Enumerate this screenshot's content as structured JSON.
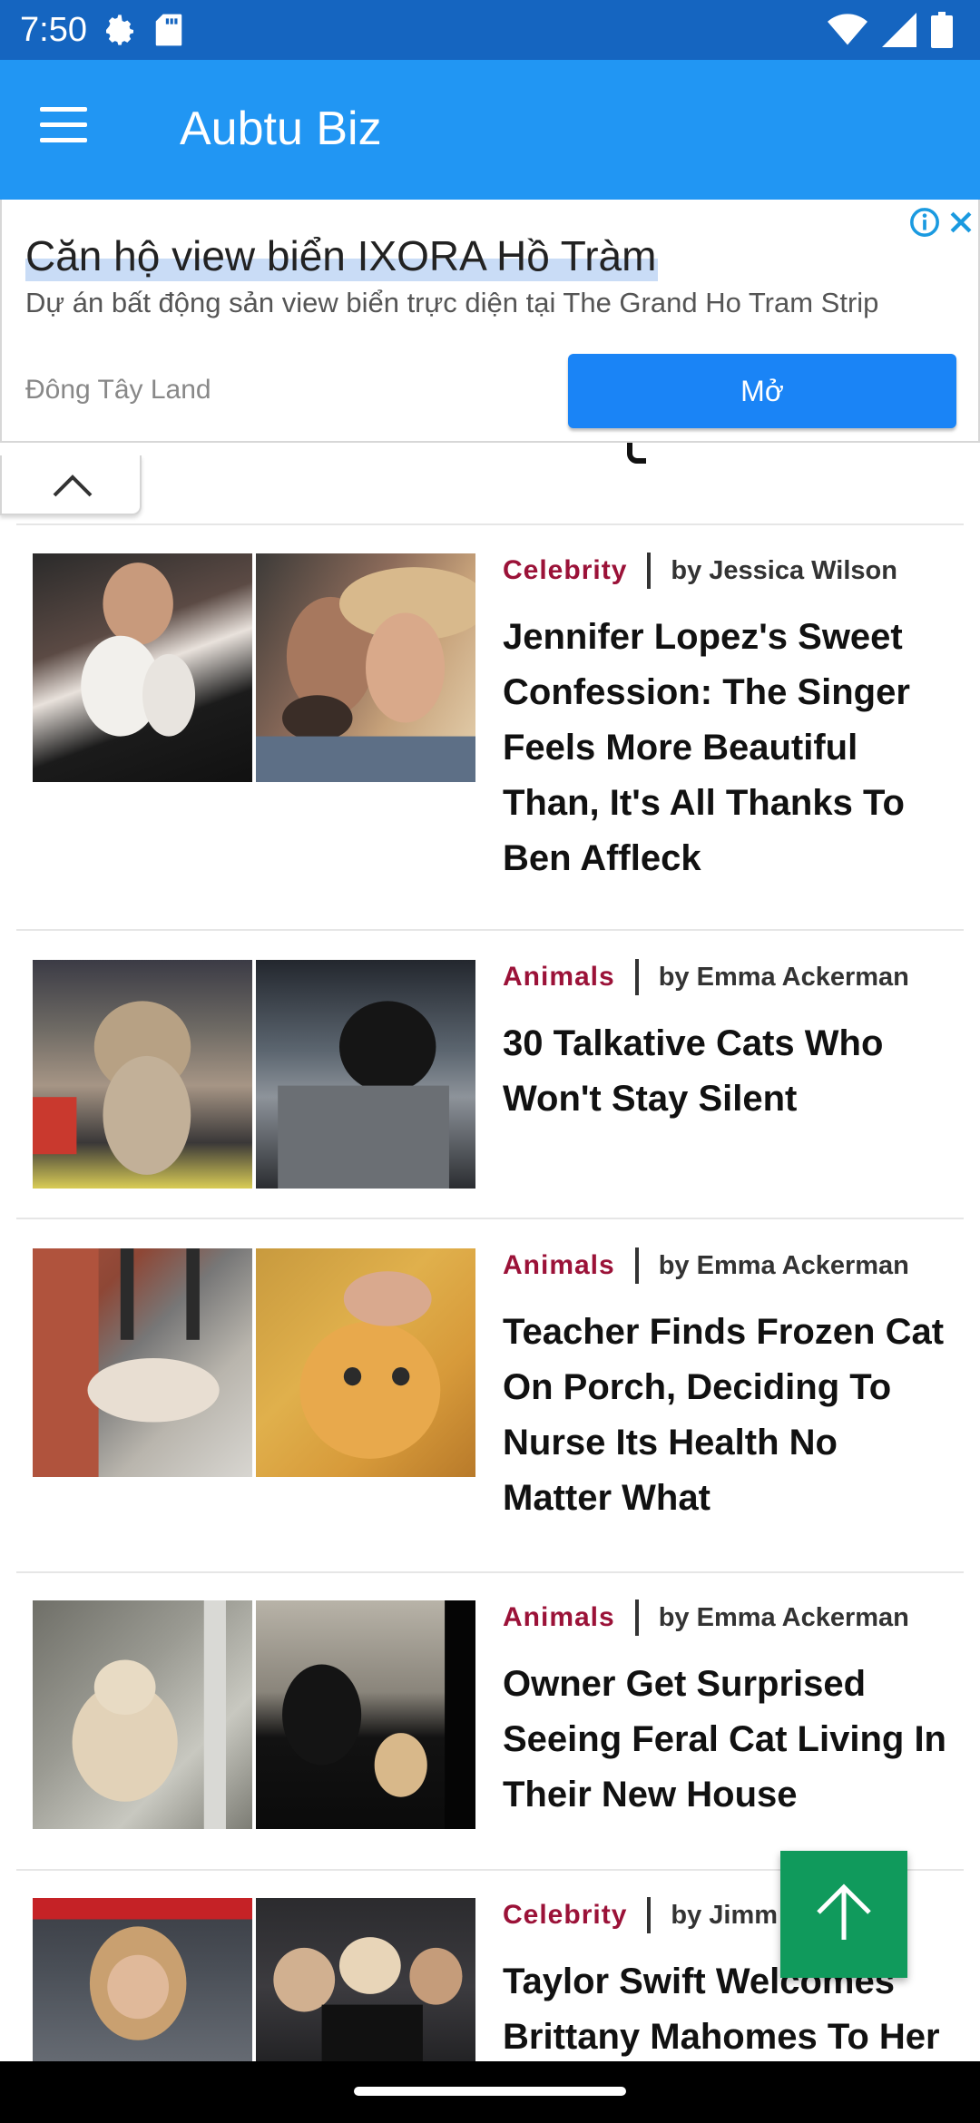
{
  "status_bar": {
    "time": "7:50",
    "left_icons": [
      "settings-icon",
      "sd-card-icon"
    ],
    "right_icons": [
      "wifi-icon",
      "signal-icon",
      "battery-icon"
    ]
  },
  "app_bar": {
    "title": "Aubtu Biz",
    "menu_icon": "hamburger-menu-icon"
  },
  "ad": {
    "title": "Căn hộ view biển IXORA Hồ Tràm",
    "description": "Dự án bất động sản view biển trực diện tại The Grand Ho Tram Strip",
    "source": "Đông Tây Land",
    "button_label": "Mở",
    "icons": [
      "ad-info-icon",
      "ad-close-icon"
    ]
  },
  "articles": [
    {
      "category": "Celebrity",
      "author": "by Jessica Wilson",
      "title": "Jennifer Lopez's Sweet Confession: The Singer Feels More Beautiful Than, It's All Thanks To Ben Affleck"
    },
    {
      "category": "Animals",
      "author": "by Emma Ackerman",
      "title": "30 Talkative Cats Who Won't Stay Silent"
    },
    {
      "category": "Animals",
      "author": "by Emma Ackerman",
      "title": "Teacher Finds Frozen Cat On Porch, Deciding To Nurse Its Health No Matter What"
    },
    {
      "category": "Animals",
      "author": "by Emma Ackerman",
      "title": "Owner Get Surprised Seeing Feral Cat Living In Their New House"
    },
    {
      "category": "Celebrity",
      "author": "by Jimm",
      "title": "Taylor Swift Welcomes Brittany Mahomes To Her"
    }
  ],
  "colors": {
    "status_bar": "#1565c0",
    "app_bar": "#2196f3",
    "category": "#9b1238",
    "ad_button": "#1a84f6",
    "back_to_top": "#109a5c"
  }
}
